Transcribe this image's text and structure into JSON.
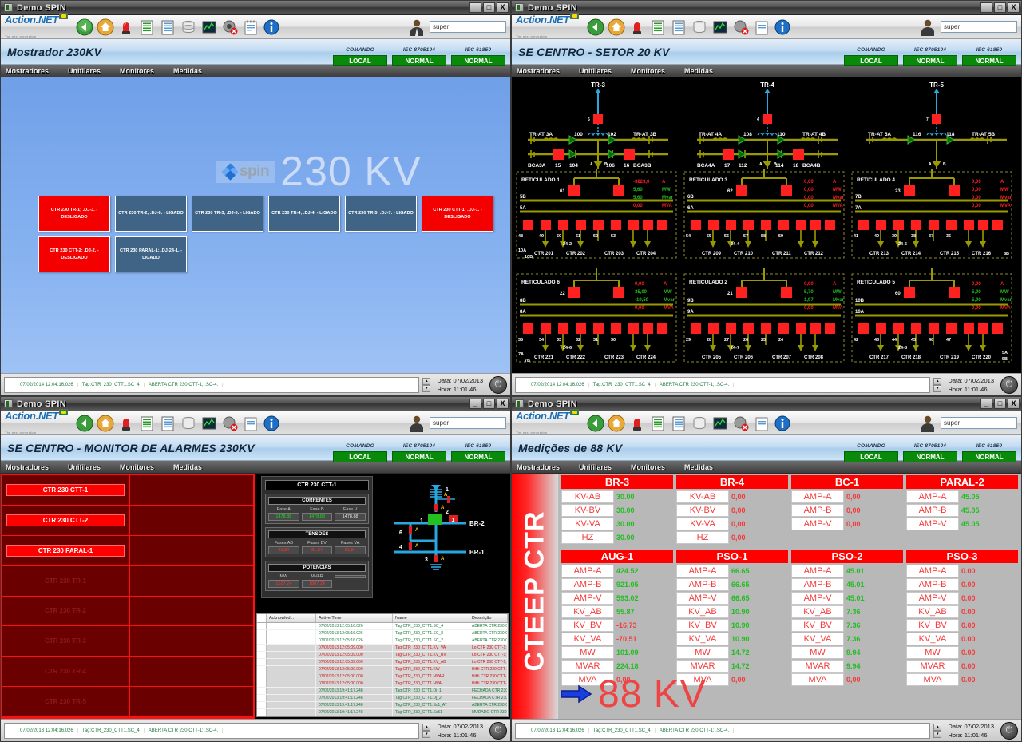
{
  "window": {
    "title": "Demo SPIN",
    "minimize": "_",
    "maximize": "□",
    "close": "X"
  },
  "toolbar": {
    "logo": "Action",
    "logo_net": ".NET",
    "logo_sub": "The next generation",
    "user": "super",
    "icons": [
      "back-icon",
      "home-icon",
      "alarm-beacon-icon",
      "green-list-icon",
      "blue-list-icon",
      "database-icon",
      "trend-chart-icon",
      "sound-off-icon",
      "notepad-icon",
      "info-icon"
    ]
  },
  "status_indicators": [
    {
      "label": "COMANDO",
      "value": "LOCAL"
    },
    {
      "label": "IEC 8705104",
      "value": "NORMAL"
    },
    {
      "label": "IEC 61850",
      "value": "NORMAL"
    }
  ],
  "menu": [
    "Mostradores",
    "Unifilares",
    "Monitores",
    "Medidas"
  ],
  "statusbar": {
    "time": "07/02/2014 12:04:16.026",
    "tag": "Tag:CTR_230_CTT1.SC_4",
    "desc": "ABERTA CTR 230 CTT-1; .SC-4.",
    "date_label": "Data:",
    "date_value": "07/02/2013",
    "hour_label": "Hora:",
    "hour_value": "11:01:46",
    "power_icon": "power-icon"
  },
  "statusbar_alt": {
    "time": "07/02/2013 12:04:16.026",
    "tag": "Tag:CTR_230_CTT1.SC_4",
    "desc": "ABERTA CTR 230 CTT-1; .SC-4."
  },
  "panel_mostrador": {
    "title": "Mostrador 230KV",
    "watermark_brand": "spin",
    "watermark_kv": "230 KV",
    "buttons": [
      {
        "label": "CTR 230 TR-1; .DJ-3. - DESLIGADO",
        "state": "off"
      },
      {
        "label": "CTR 230 TR-2; .DJ-6. - LIGADO",
        "state": "on"
      },
      {
        "label": "CTR 230 TR-3; .DJ-5. - LIGADO",
        "state": "on"
      },
      {
        "label": "CTR 230 TR-4; .DJ-4. - LIGADO",
        "state": "on"
      },
      {
        "label": "CTR 230 TR-5; .DJ-7. - LIGADO",
        "state": "on"
      },
      {
        "label": "CTR 230 CTT-1; .DJ-1. - DESLIGADO",
        "state": "off"
      },
      {
        "label": "CTR 230 CTT-2; .DJ-2. - DESLIGADO",
        "state": "off"
      },
      {
        "label": "CTR 230 PARAL-1; .DJ-24-1. - LIGADO",
        "state": "on"
      }
    ]
  },
  "panel_unifilar": {
    "title": "SE CENTRO - SETOR 20 KV",
    "transformers": [
      {
        "name": "TR-3",
        "node": "5",
        "left_label": "TR-AT 3A",
        "left_num": "100",
        "right_num": "102",
        "right_label": "TR-AT 3B",
        "bca_left": "BCA3A",
        "bca_l_num": "15",
        "bca_l_num2": "104",
        "bca_r_num": "106",
        "bca_r_num2": "16",
        "bca_right": "BCA3B"
      },
      {
        "name": "TR-4",
        "node": "4",
        "left_label": "TR-AT 4A",
        "left_num": "108",
        "right_num": "110",
        "right_label": "TR-AT 4B",
        "bca_left": "BCA4A",
        "bca_l_num": "17",
        "bca_l_num2": "112",
        "bca_r_num": "114",
        "bca_r_num2": "18",
        "bca_right": "BCA4B"
      },
      {
        "name": "TR-5",
        "node": "7",
        "left_label": "TR-AT 5A",
        "left_num": "116",
        "right_num": "118",
        "right_label": "TR-AT 5B",
        "bca_left": "",
        "bca_l_num": "",
        "bca_l_num2": "",
        "bca_r_num": "",
        "bca_r_num2": "",
        "bca_right": ""
      }
    ],
    "reticulados": [
      {
        "name": "RETICULADO 1",
        "node": "61",
        "bus_hi": "5B",
        "bus_lo": "5A",
        "meas": [
          {
            "v": "-3823,0",
            "u": "A",
            "c": "r"
          },
          {
            "v": "5,60",
            "u": "MW",
            "c": "g"
          },
          {
            "v": "5,60",
            "u": "Mvar",
            "c": "g"
          },
          {
            "v": "0,00",
            "u": "MVA",
            "c": "r"
          }
        ],
        "nums": [
          "48",
          "49",
          "50",
          "51",
          "52",
          "53"
        ],
        "tie": "24-2",
        "feeders": [
          "CTR 201",
          "CTR 202",
          "CTR 203",
          "CTR 204"
        ],
        "drop_left": [
          "10A",
          "10B"
        ]
      },
      {
        "name": "RETICULADO 3",
        "node": "62",
        "bus_hi": "6B",
        "bus_lo": "6A",
        "meas": [
          {
            "v": "0,00",
            "u": "A",
            "c": "r"
          },
          {
            "v": "0,00",
            "u": "MW",
            "c": "r"
          },
          {
            "v": "0,00",
            "u": "Mvar",
            "c": "r"
          },
          {
            "v": "0,00",
            "u": "MVA",
            "c": "r"
          }
        ],
        "nums": [
          "54",
          "55",
          "56",
          "57",
          "58",
          "59"
        ],
        "tie": "24-4",
        "feeders": [
          "CTR 209",
          "CTR 210",
          "CTR 211",
          "CTR 212"
        ],
        "drop_left": [
          "",
          ""
        ]
      },
      {
        "name": "RETICULADO 4",
        "node": "23",
        "bus_hi": "7B",
        "bus_lo": "7A",
        "meas": [
          {
            "v": "0,00",
            "u": "A",
            "c": "r"
          },
          {
            "v": "0,00",
            "u": "MW",
            "c": "r"
          },
          {
            "v": "0,00",
            "u": "Mvar",
            "c": "r"
          },
          {
            "v": "0,00",
            "u": "MVA",
            "c": "r"
          }
        ],
        "nums": [
          "41",
          "40",
          "39",
          "38",
          "37",
          "36"
        ],
        "tie": "24-5",
        "feeders": [
          "CTR 213",
          "CTR 214",
          "CTR 215",
          "CTR 216"
        ],
        "drop_left": [
          "",
          "8B"
        ]
      },
      {
        "name": "RETICULADO 6",
        "node": "22",
        "bus_hi": "8B",
        "bus_lo": "8A",
        "meas": [
          {
            "v": "0,00",
            "u": "A",
            "c": "r"
          },
          {
            "v": "35,00",
            "u": "MW",
            "c": "g"
          },
          {
            "v": "-19,50",
            "u": "Mvar",
            "c": "g"
          },
          {
            "v": "0,00",
            "u": "MVA",
            "c": "r"
          }
        ],
        "nums": [
          "35",
          "34",
          "33",
          "32",
          "31",
          "30"
        ],
        "tie": "24-6",
        "feeders": [
          "CTR 221",
          "CTR 222",
          "CTR 223",
          "CTR 224"
        ],
        "drop_left": [
          "7A",
          "7B"
        ]
      },
      {
        "name": "RETICULADO 2",
        "node": "21",
        "bus_hi": "9B",
        "bus_lo": "9A",
        "meas": [
          {
            "v": "0,00",
            "u": "A",
            "c": "r"
          },
          {
            "v": "5,70",
            "u": "MW",
            "c": "g"
          },
          {
            "v": "1,97",
            "u": "Mvar",
            "c": "g"
          },
          {
            "v": "0,00",
            "u": "MVA",
            "c": "r"
          }
        ],
        "nums": [
          "29",
          "28",
          "27",
          "26",
          "25",
          "24"
        ],
        "tie": "24-7",
        "feeders": [
          "CTR 205",
          "CTR 206",
          "CTR 207",
          "CTR 208"
        ],
        "drop_left": [
          "",
          ""
        ]
      },
      {
        "name": "RETICULADO 5",
        "node": "60",
        "bus_hi": "10B",
        "bus_lo": "10A",
        "meas": [
          {
            "v": "0,00",
            "u": "A",
            "c": "r"
          },
          {
            "v": "5,90",
            "u": "MW",
            "c": "g"
          },
          {
            "v": "5,90",
            "u": "Mvar",
            "c": "g"
          },
          {
            "v": "0,00",
            "u": "MVA",
            "c": "r"
          }
        ],
        "nums": [
          "42",
          "43",
          "44",
          "45",
          "46",
          "47"
        ],
        "tie": "24-8",
        "feeders": [
          "CTR 217",
          "CTR 218",
          "CTR 219",
          "CTR 220"
        ],
        "drop_left": [
          "5A",
          "5B"
        ]
      }
    ]
  },
  "panel_alarmes": {
    "title": "SE CENTRO - MONITOR DE ALARMES 230KV",
    "alarm_rows": [
      {
        "label": "CTR 230 CTT-1",
        "state": "active"
      },
      {
        "label": "CTR 230 CTT-2",
        "state": "active"
      },
      {
        "label": "CTR 230 PARAL-1",
        "state": "active"
      },
      {
        "label": "CTR 230 TR-1",
        "state": "idle"
      },
      {
        "label": "CTR 230 TR-2",
        "state": "idle"
      },
      {
        "label": "CTR 230 TR-3",
        "state": "idle"
      },
      {
        "label": "CTR 230 TR-4",
        "state": "idle"
      },
      {
        "label": "CTR 230 TR-5",
        "state": "idle"
      }
    ],
    "measure_box": {
      "title": "CTR 230 CTT-1",
      "sections": [
        {
          "header": "CORRENTES",
          "cells": [
            {
              "label": "Fase A",
              "value": "1478,88",
              "color": "grn"
            },
            {
              "label": "Fase B",
              "value": "1478,88",
              "color": "grn"
            },
            {
              "label": "Fase V",
              "value": "1478,88",
              "color": "wht"
            }
          ]
        },
        {
          "header": "TENSOES",
          "cells": [
            {
              "label": "Fases AB",
              "value": "81,84",
              "color": "red"
            },
            {
              "label": "Fases BV",
              "value": "81,84",
              "color": "red"
            },
            {
              "label": "Fases VA",
              "value": "81,84",
              "color": "red"
            }
          ]
        },
        {
          "header": "POTENCIAS",
          "cells": [
            {
              "label": "MW",
              "value": "1527,24",
              "color": "red"
            },
            {
              "label": "MVAR",
              "value": "1887,24",
              "color": "red"
            },
            {
              "label": "",
              "value": "",
              "color": "wht"
            }
          ]
        }
      ]
    },
    "sld": {
      "bus_upper": "BR-2",
      "bus_lower": "BR-1",
      "nodes": [
        "1",
        "2",
        "1",
        "6",
        "4",
        "3"
      ],
      "badge": "1"
    },
    "log": {
      "columns": [
        "Acknowled...",
        "Active Time",
        "Name",
        "Descrição"
      ],
      "rows": [
        {
          "time": "07/02/2013 12:05:16.026",
          "name": "Tag:CTR_230_CTT1.SC_4",
          "desc": "ABERTA CTR 230 CTT-1; .SC-4.",
          "color": "grn"
        },
        {
          "time": "07/02/2013 12:05:16.026",
          "name": "Tag:CTR_230_CTT1.SC_8",
          "desc": "ABERTA CTR 230 CTT-1; .SC-8.",
          "color": "grn"
        },
        {
          "time": "07/02/2013 12:05:16.026",
          "name": "Tag:CTR_230_CTT1.SC_2",
          "desc": "ABERTA CTR 230 CTT-1; .SC-2.",
          "color": "grn"
        },
        {
          "time": "07/02/2013 12:05:09.000",
          "name": "Tag:CTR_230_CTT1.KV_VA",
          "desc": "Lo CTR 230 CTT-1; .KV FASE VA",
          "color": "red"
        },
        {
          "time": "07/02/2013 12:05:09.000",
          "name": "Tag:CTR_230_CTT1.KV_BV",
          "desc": "Lo CTR 230 CTT-1; .KV FASE BV",
          "color": "red"
        },
        {
          "time": "07/02/2013 12:05:09.000",
          "name": "Tag:CTR_230_CTT1.KV_AB",
          "desc": "Lo CTR 230 CTT-1; .KV FASE AB",
          "color": "red"
        },
        {
          "time": "07/02/2013 12:05:00.000",
          "name": "Tag:CTR_230_CTT1.KW",
          "desc": "HiHi CTR 230 CTT-1; .MW",
          "color": "red"
        },
        {
          "time": "07/02/2013 12:05:00.000",
          "name": "Tag:CTR_230_CTT1.MVAR",
          "desc": "HiHi CTR 230 CTT-1; .MVAR",
          "color": "red"
        },
        {
          "time": "07/02/2013 12:05:00.000",
          "name": "Tag:CTR_230_CTT1.MVA",
          "desc": "HiHi CTR 230 CTT-1; .MVA",
          "color": "red"
        },
        {
          "time": "07/02/2013 19:41:17.248",
          "name": "Tag:CTR_230_CTT1.Dj_1",
          "desc": "FECHADA CTR 230 CTT-1; .DJ-1.",
          "color": "grn"
        },
        {
          "time": "07/02/2013 19:41:17.248",
          "name": "Tag:CTR_230_CTT1.Dj_2",
          "desc": "FECHADA CTR 230 CTT-1; .DJ-2.",
          "color": "grn"
        },
        {
          "time": "07/02/2013 19:41:17.248",
          "name": "Tag:CTR_230_CTT1.Sc1_AT",
          "desc": "ABERTA CTR 230 CTT-1; .Sc-1.AT-01.",
          "color": "grn"
        },
        {
          "time": "07/02/2013 19:41:17.248",
          "name": "Tag:CTR_230_CTT1.Sc51",
          "desc": "MUDADO CTR 230 CTT-1; .Sc-1.",
          "color": "grn"
        }
      ]
    }
  },
  "panel_medicoes": {
    "title": "Medições de 88 KV",
    "side_label": "CTEEP CTR",
    "footer_kv": "88 KV",
    "blocks": [
      {
        "header": "BR-3",
        "rows": [
          {
            "label": "KV-AB",
            "value": "30.00",
            "color": "g"
          },
          {
            "label": "KV-BV",
            "value": "30.00",
            "color": "g"
          },
          {
            "label": "KV-VA",
            "value": "30.00",
            "color": "g"
          },
          {
            "label": "HZ",
            "value": "30.00",
            "color": "g"
          }
        ]
      },
      {
        "header": "BR-4",
        "rows": [
          {
            "label": "KV-AB",
            "value": "0,00",
            "color": "r"
          },
          {
            "label": "KV-BV",
            "value": "0,00",
            "color": "r"
          },
          {
            "label": "KV-VA",
            "value": "0,00",
            "color": "r"
          },
          {
            "label": "HZ",
            "value": "0,00",
            "color": "r"
          }
        ]
      },
      {
        "header": "BC-1",
        "rows": [
          {
            "label": "AMP-A",
            "value": "0,00",
            "color": "r"
          },
          {
            "label": "AMP-B",
            "value": "0,00",
            "color": "r"
          },
          {
            "label": "AMP-V",
            "value": "0,00",
            "color": "r"
          }
        ]
      },
      {
        "header": "PARAL-2",
        "rows": [
          {
            "label": "AMP-A",
            "value": "45.05",
            "color": "g"
          },
          {
            "label": "AMP-B",
            "value": "45.05",
            "color": "g"
          },
          {
            "label": "AMP-V",
            "value": "45.05",
            "color": "g"
          }
        ]
      }
    ],
    "blocks2": [
      {
        "header": "AUG-1",
        "rows": [
          {
            "label": "AMP-A",
            "value": "424.52",
            "color": "g"
          },
          {
            "label": "AMP-B",
            "value": "921.05",
            "color": "g"
          },
          {
            "label": "AMP-V",
            "value": "593.02",
            "color": "g"
          },
          {
            "label": "KV_AB",
            "value": "55.87",
            "color": "g"
          },
          {
            "label": "KV_BV",
            "value": "-16,73",
            "color": "r"
          },
          {
            "label": "KV_VA",
            "value": "-70,51",
            "color": "r"
          },
          {
            "label": "MW",
            "value": "101.09",
            "color": "g"
          },
          {
            "label": "MVAR",
            "value": "224.18",
            "color": "g"
          },
          {
            "label": "MVA",
            "value": "0,00",
            "color": "r"
          }
        ]
      },
      {
        "header": "PSO-1",
        "rows": [
          {
            "label": "AMP-A",
            "value": "66.65",
            "color": "g"
          },
          {
            "label": "AMP-B",
            "value": "66.65",
            "color": "g"
          },
          {
            "label": "AMP-V",
            "value": "66.65",
            "color": "g"
          },
          {
            "label": "KV_AB",
            "value": "10.90",
            "color": "g"
          },
          {
            "label": "KV_BV",
            "value": "10.90",
            "color": "g"
          },
          {
            "label": "KV_VA",
            "value": "10.90",
            "color": "g"
          },
          {
            "label": "MW",
            "value": "14.72",
            "color": "g"
          },
          {
            "label": "MVAR",
            "value": "14.72",
            "color": "g"
          },
          {
            "label": "MVA",
            "value": "0,00",
            "color": "r"
          }
        ]
      },
      {
        "header": "PSO-2",
        "rows": [
          {
            "label": "AMP-A",
            "value": "45.01",
            "color": "g"
          },
          {
            "label": "AMP-B",
            "value": "45.01",
            "color": "g"
          },
          {
            "label": "AMP-V",
            "value": "45.01",
            "color": "g"
          },
          {
            "label": "KV_AB",
            "value": "7.36",
            "color": "g"
          },
          {
            "label": "KV_BV",
            "value": "7.36",
            "color": "g"
          },
          {
            "label": "KV_VA",
            "value": "7.36",
            "color": "g"
          },
          {
            "label": "MW",
            "value": "9.94",
            "color": "g"
          },
          {
            "label": "MVAR",
            "value": "9.94",
            "color": "g"
          },
          {
            "label": "MVA",
            "value": "0,00",
            "color": "r"
          }
        ]
      },
      {
        "header": "PSO-3",
        "rows": [
          {
            "label": "AMP-A",
            "value": "0.00",
            "color": "r"
          },
          {
            "label": "AMP-B",
            "value": "0.00",
            "color": "r"
          },
          {
            "label": "AMP-V",
            "value": "0.00",
            "color": "r"
          },
          {
            "label": "KV_AB",
            "value": "0.00",
            "color": "r"
          },
          {
            "label": "KV_BV",
            "value": "0.00",
            "color": "r"
          },
          {
            "label": "KV_VA",
            "value": "0.00",
            "color": "r"
          },
          {
            "label": "MW",
            "value": "0.00",
            "color": "r"
          },
          {
            "label": "MVAR",
            "value": "0.00",
            "color": "r"
          },
          {
            "label": "MVA",
            "value": "0.00",
            "color": "r"
          }
        ]
      }
    ]
  },
  "colors": {
    "alarm_red": "#ff0000",
    "ok_green": "#0a8a0a",
    "bus_olive": "#9a9a00",
    "device_red": "#ff2020",
    "value_green": "#1fbf1f",
    "panel_blue": "#3f6485"
  }
}
